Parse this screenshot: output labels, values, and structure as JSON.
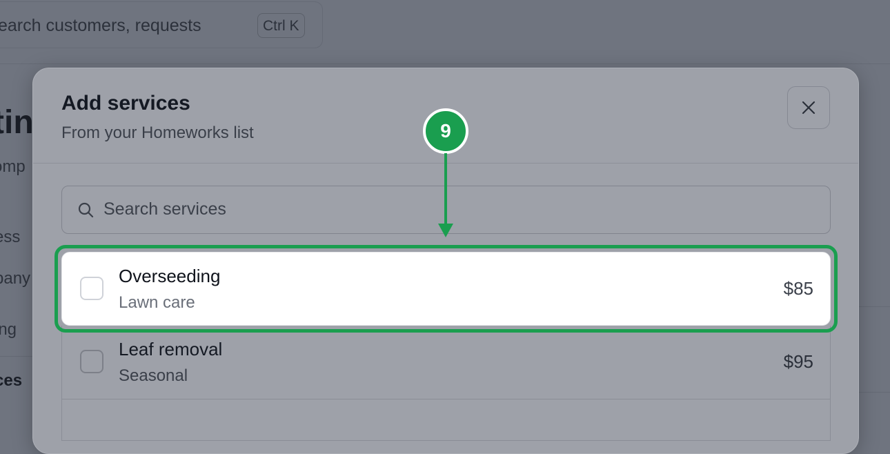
{
  "background": {
    "search_text": "earch customers, requests",
    "search_shortcut": "Ctrl K",
    "page_heading": "tin",
    "page_sub": "omp",
    "nav_items": [
      "ess",
      "bany",
      "ing",
      "ces"
    ]
  },
  "modal": {
    "title": "Add services",
    "subtitle": "From your Homeworks list",
    "close_icon": "close-icon",
    "search": {
      "placeholder": "Search services",
      "value": ""
    },
    "services": [
      {
        "name": "Overseeding",
        "category": "Lawn care",
        "price": "$85",
        "checked": false,
        "highlighted": true
      },
      {
        "name": "Leaf removal",
        "category": "Seasonal",
        "price": "$95",
        "checked": false,
        "highlighted": false
      }
    ]
  },
  "annotation": {
    "step_number": "9",
    "color": "#1a9e4f"
  },
  "colors": {
    "overlay": "#6f747f",
    "modal_bg": "#9ea1a9",
    "highlight_bg": "#ffffff",
    "accent_green": "#1a9e4f"
  }
}
